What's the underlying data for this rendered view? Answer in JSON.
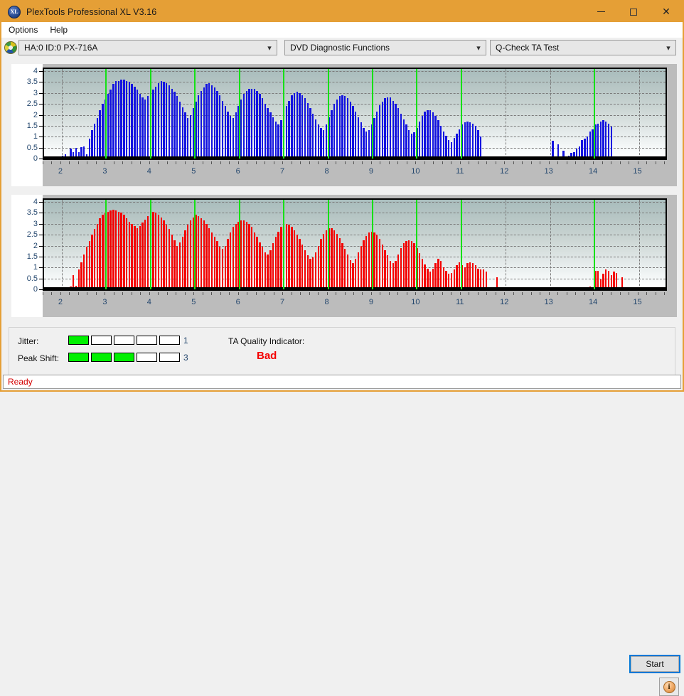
{
  "window": {
    "title": "PlexTools Professional XL V3.16",
    "app_icon": "XL",
    "controls": {
      "minimize": "minimize-icon",
      "maximize": "maximize-icon",
      "close": "close-icon"
    }
  },
  "menu": {
    "items": [
      "Options",
      "Help"
    ]
  },
  "selectors": {
    "drive": {
      "value": "HA:0 ID:0  PX-716A",
      "icon": "disc-icon"
    },
    "function": {
      "value": "DVD Diagnostic Functions"
    },
    "test": {
      "value": "Q-Check TA Test"
    }
  },
  "indicators": {
    "jitter_label": "Jitter:",
    "jitter_value": "1",
    "jitter_filled": 1,
    "jitter_total": 5,
    "peakshift_label": "Peak Shift:",
    "peakshift_value": "3",
    "peakshift_filled": 3,
    "peakshift_total": 5,
    "ta_quality_label": "TA Quality Indicator:",
    "ta_quality_value": "Bad",
    "ta_quality_color": "#f40000",
    "meter_on_color": "#00f000"
  },
  "buttons": {
    "start": "Start",
    "info": "i"
  },
  "status": {
    "text": "Ready",
    "color": "#d40000"
  },
  "chart_data": [
    {
      "id": "jitter-chart",
      "type": "bar",
      "title": "",
      "xlabel": "",
      "ylabel": "",
      "color": "#1414e0",
      "marker_color": "#16e016",
      "grid": true,
      "ylim": [
        0,
        4
      ],
      "yticks": [
        0,
        0.5,
        1,
        1.5,
        2,
        2.5,
        3,
        3.5,
        4
      ],
      "xlim": [
        1.6,
        15.6
      ],
      "xticks": [
        2,
        3,
        4,
        5,
        6,
        7,
        8,
        9,
        10,
        11,
        12,
        13,
        14,
        15
      ],
      "markers": [
        3,
        4,
        5,
        6,
        7,
        8,
        9,
        10,
        11,
        14
      ],
      "x": [
        1.72,
        1.78,
        1.84,
        1.9,
        1.96,
        2.02,
        2.08,
        2.14,
        2.2,
        2.26,
        2.32,
        2.38,
        2.44,
        2.5,
        2.56,
        2.62,
        2.68,
        2.74,
        2.8,
        2.86,
        2.92,
        2.98,
        3.04,
        3.1,
        3.16,
        3.22,
        3.28,
        3.34,
        3.4,
        3.46,
        3.52,
        3.58,
        3.64,
        3.7,
        3.76,
        3.82,
        3.88,
        3.94,
        4.0,
        4.06,
        4.12,
        4.18,
        4.24,
        4.3,
        4.36,
        4.42,
        4.48,
        4.54,
        4.6,
        4.66,
        4.72,
        4.78,
        4.84,
        4.9,
        4.96,
        5.02,
        5.08,
        5.14,
        5.2,
        5.26,
        5.32,
        5.38,
        5.44,
        5.5,
        5.56,
        5.62,
        5.68,
        5.74,
        5.8,
        5.86,
        5.92,
        5.98,
        6.04,
        6.1,
        6.16,
        6.22,
        6.28,
        6.34,
        6.4,
        6.46,
        6.52,
        6.58,
        6.64,
        6.7,
        6.76,
        6.82,
        6.88,
        6.94,
        7.0,
        7.06,
        7.12,
        7.18,
        7.24,
        7.3,
        7.36,
        7.42,
        7.48,
        7.54,
        7.6,
        7.66,
        7.72,
        7.78,
        7.84,
        7.9,
        7.96,
        8.02,
        8.08,
        8.14,
        8.2,
        8.26,
        8.32,
        8.38,
        8.44,
        8.5,
        8.56,
        8.62,
        8.68,
        8.74,
        8.8,
        8.86,
        8.92,
        8.98,
        9.04,
        9.1,
        9.16,
        9.22,
        9.28,
        9.34,
        9.4,
        9.46,
        9.52,
        9.58,
        9.64,
        9.7,
        9.76,
        9.82,
        9.88,
        9.94,
        10.0,
        10.06,
        10.12,
        10.18,
        10.24,
        10.3,
        10.36,
        10.42,
        10.48,
        10.54,
        10.6,
        10.66,
        10.72,
        10.78,
        10.84,
        10.9,
        10.96,
        11.02,
        11.08,
        11.14,
        11.2,
        11.26,
        11.32,
        11.38,
        11.44,
        13.06,
        13.18,
        13.3,
        13.36,
        13.42,
        13.48,
        13.54,
        13.6,
        13.66,
        13.72,
        13.78,
        13.84,
        13.9,
        13.96,
        14.02,
        14.08,
        14.14,
        14.2,
        14.26,
        14.32,
        14.38
      ],
      "values": [
        0.04,
        0.0,
        0.05,
        0.1,
        0.06,
        0.12,
        0.2,
        0.1,
        0.45,
        0.28,
        0.5,
        0.3,
        0.52,
        0.55,
        0.2,
        0.9,
        1.3,
        1.6,
        1.85,
        2.2,
        2.5,
        2.7,
        2.95,
        3.15,
        3.4,
        3.55,
        3.55,
        3.6,
        3.6,
        3.55,
        3.5,
        3.4,
        3.3,
        3.15,
        2.95,
        2.8,
        2.7,
        2.85,
        3.0,
        3.15,
        3.3,
        3.45,
        3.55,
        3.5,
        3.45,
        3.35,
        3.2,
        3.05,
        2.85,
        2.6,
        2.35,
        2.1,
        1.85,
        2.0,
        2.3,
        2.6,
        2.9,
        3.1,
        3.25,
        3.4,
        3.45,
        3.35,
        3.25,
        3.1,
        2.9,
        2.65,
        2.4,
        2.15,
        1.95,
        1.85,
        2.1,
        2.4,
        2.7,
        2.95,
        3.1,
        3.2,
        3.2,
        3.2,
        3.1,
        2.95,
        2.75,
        2.5,
        2.3,
        2.1,
        1.9,
        1.7,
        1.55,
        1.75,
        2.1,
        2.4,
        2.65,
        2.9,
        3.0,
        3.05,
        3.0,
        2.9,
        2.75,
        2.55,
        2.3,
        2.05,
        1.8,
        1.55,
        1.4,
        1.3,
        1.55,
        1.9,
        2.2,
        2.5,
        2.7,
        2.85,
        2.9,
        2.85,
        2.75,
        2.6,
        2.4,
        2.15,
        1.9,
        1.65,
        1.4,
        1.25,
        1.3,
        1.55,
        1.85,
        2.15,
        2.45,
        2.6,
        2.75,
        2.8,
        2.8,
        2.65,
        2.5,
        2.3,
        2.05,
        1.8,
        1.55,
        1.3,
        1.15,
        1.2,
        1.4,
        1.7,
        1.95,
        2.15,
        2.2,
        2.2,
        2.1,
        1.95,
        1.75,
        1.5,
        1.25,
        1.05,
        0.85,
        0.75,
        0.95,
        1.15,
        1.35,
        1.55,
        1.65,
        1.7,
        1.65,
        1.6,
        1.5,
        1.3,
        1.0,
        0.8,
        0.65,
        0.35,
        0.08,
        0.12,
        0.25,
        0.3,
        0.45,
        0.55,
        0.85,
        0.9,
        1.0,
        1.25,
        1.35,
        1.55,
        1.6,
        1.7,
        1.75,
        1.7,
        1.6,
        1.45,
        1.2,
        1.0,
        0.75
      ]
    },
    {
      "id": "peak-shift-chart",
      "type": "bar",
      "title": "",
      "xlabel": "",
      "ylabel": "",
      "color": "#f40000",
      "marker_color": "#16e016",
      "grid": true,
      "ylim": [
        0,
        4
      ],
      "yticks": [
        0,
        0.5,
        1,
        1.5,
        2,
        2.5,
        3,
        3.5,
        4
      ],
      "xlim": [
        1.6,
        15.6
      ],
      "xticks": [
        2,
        3,
        4,
        5,
        6,
        7,
        8,
        9,
        10,
        11,
        12,
        13,
        14,
        15
      ],
      "markers": [
        3,
        4,
        5,
        6,
        7,
        8,
        9,
        10,
        11,
        14
      ],
      "x": [
        1.72,
        1.9,
        2.02,
        2.2,
        2.26,
        2.32,
        2.38,
        2.44,
        2.5,
        2.56,
        2.62,
        2.68,
        2.74,
        2.8,
        2.86,
        2.92,
        2.98,
        3.04,
        3.1,
        3.16,
        3.22,
        3.28,
        3.34,
        3.4,
        3.46,
        3.52,
        3.58,
        3.64,
        3.7,
        3.76,
        3.82,
        3.88,
        3.94,
        4.0,
        4.06,
        4.12,
        4.18,
        4.24,
        4.3,
        4.36,
        4.42,
        4.48,
        4.54,
        4.6,
        4.66,
        4.72,
        4.78,
        4.84,
        4.9,
        4.96,
        5.02,
        5.08,
        5.14,
        5.2,
        5.26,
        5.32,
        5.38,
        5.44,
        5.5,
        5.56,
        5.62,
        5.68,
        5.74,
        5.8,
        5.86,
        5.92,
        5.98,
        6.04,
        6.1,
        6.16,
        6.22,
        6.28,
        6.34,
        6.4,
        6.46,
        6.52,
        6.58,
        6.64,
        6.7,
        6.76,
        6.82,
        6.88,
        6.94,
        7.0,
        7.06,
        7.12,
        7.18,
        7.24,
        7.3,
        7.36,
        7.42,
        7.48,
        7.54,
        7.6,
        7.66,
        7.72,
        7.78,
        7.84,
        7.9,
        7.96,
        8.02,
        8.08,
        8.14,
        8.2,
        8.26,
        8.32,
        8.38,
        8.44,
        8.5,
        8.56,
        8.62,
        8.68,
        8.74,
        8.8,
        8.86,
        8.92,
        8.98,
        9.04,
        9.1,
        9.16,
        9.22,
        9.28,
        9.34,
        9.4,
        9.46,
        9.52,
        9.58,
        9.64,
        9.7,
        9.76,
        9.82,
        9.88,
        9.94,
        10.0,
        10.06,
        10.12,
        10.18,
        10.24,
        10.3,
        10.36,
        10.42,
        10.48,
        10.54,
        10.6,
        10.66,
        10.72,
        10.78,
        10.84,
        10.9,
        10.96,
        11.02,
        11.08,
        11.14,
        11.2,
        11.26,
        11.32,
        11.38,
        11.44,
        11.5,
        11.56,
        11.8,
        13.9,
        13.96,
        14.02,
        14.08,
        14.14,
        14.2,
        14.26,
        14.32,
        14.38,
        14.44,
        14.5,
        14.62
      ],
      "values": [
        0.06,
        0.07,
        0.1,
        0.12,
        0.65,
        0.15,
        0.9,
        1.25,
        1.6,
        1.95,
        2.2,
        2.5,
        2.75,
        3.0,
        3.25,
        3.4,
        3.5,
        3.55,
        3.6,
        3.65,
        3.6,
        3.55,
        3.5,
        3.4,
        3.25,
        3.1,
        3.0,
        2.9,
        2.8,
        2.9,
        3.05,
        3.2,
        3.35,
        3.5,
        3.55,
        3.5,
        3.4,
        3.3,
        3.15,
        2.95,
        2.75,
        2.5,
        2.25,
        2.0,
        2.15,
        2.4,
        2.7,
        2.95,
        3.15,
        3.3,
        3.4,
        3.35,
        3.25,
        3.15,
        3.0,
        2.8,
        2.6,
        2.4,
        2.2,
        1.95,
        1.85,
        2.0,
        2.3,
        2.6,
        2.85,
        3.0,
        3.1,
        3.15,
        3.15,
        3.1,
        3.0,
        2.85,
        2.6,
        2.4,
        2.15,
        1.95,
        1.7,
        1.6,
        1.8,
        2.1,
        2.4,
        2.65,
        2.85,
        2.95,
        3.0,
        2.95,
        2.85,
        2.7,
        2.5,
        2.3,
        2.05,
        1.8,
        1.55,
        1.4,
        1.45,
        1.7,
        2.0,
        2.3,
        2.55,
        2.7,
        2.8,
        2.8,
        2.7,
        2.55,
        2.35,
        2.1,
        1.85,
        1.6,
        1.35,
        1.2,
        1.4,
        1.7,
        2.0,
        2.25,
        2.45,
        2.6,
        2.65,
        2.6,
        2.5,
        2.3,
        2.05,
        1.8,
        1.55,
        1.3,
        1.2,
        1.3,
        1.6,
        1.9,
        2.1,
        2.2,
        2.25,
        2.2,
        2.1,
        1.9,
        1.65,
        1.4,
        1.15,
        0.95,
        0.8,
        0.95,
        1.2,
        1.4,
        1.3,
        1.0,
        0.85,
        0.7,
        0.75,
        0.9,
        1.1,
        1.25,
        1.1,
        1.0,
        1.2,
        1.25,
        1.2,
        1.1,
        0.95,
        0.9,
        0.9,
        0.8,
        0.55,
        0.12,
        0.1,
        0.85,
        0.85,
        0.45,
        0.7,
        0.9,
        0.85,
        0.65,
        0.8,
        0.75,
        0.55,
        0.55,
        0.15
      ]
    }
  ]
}
